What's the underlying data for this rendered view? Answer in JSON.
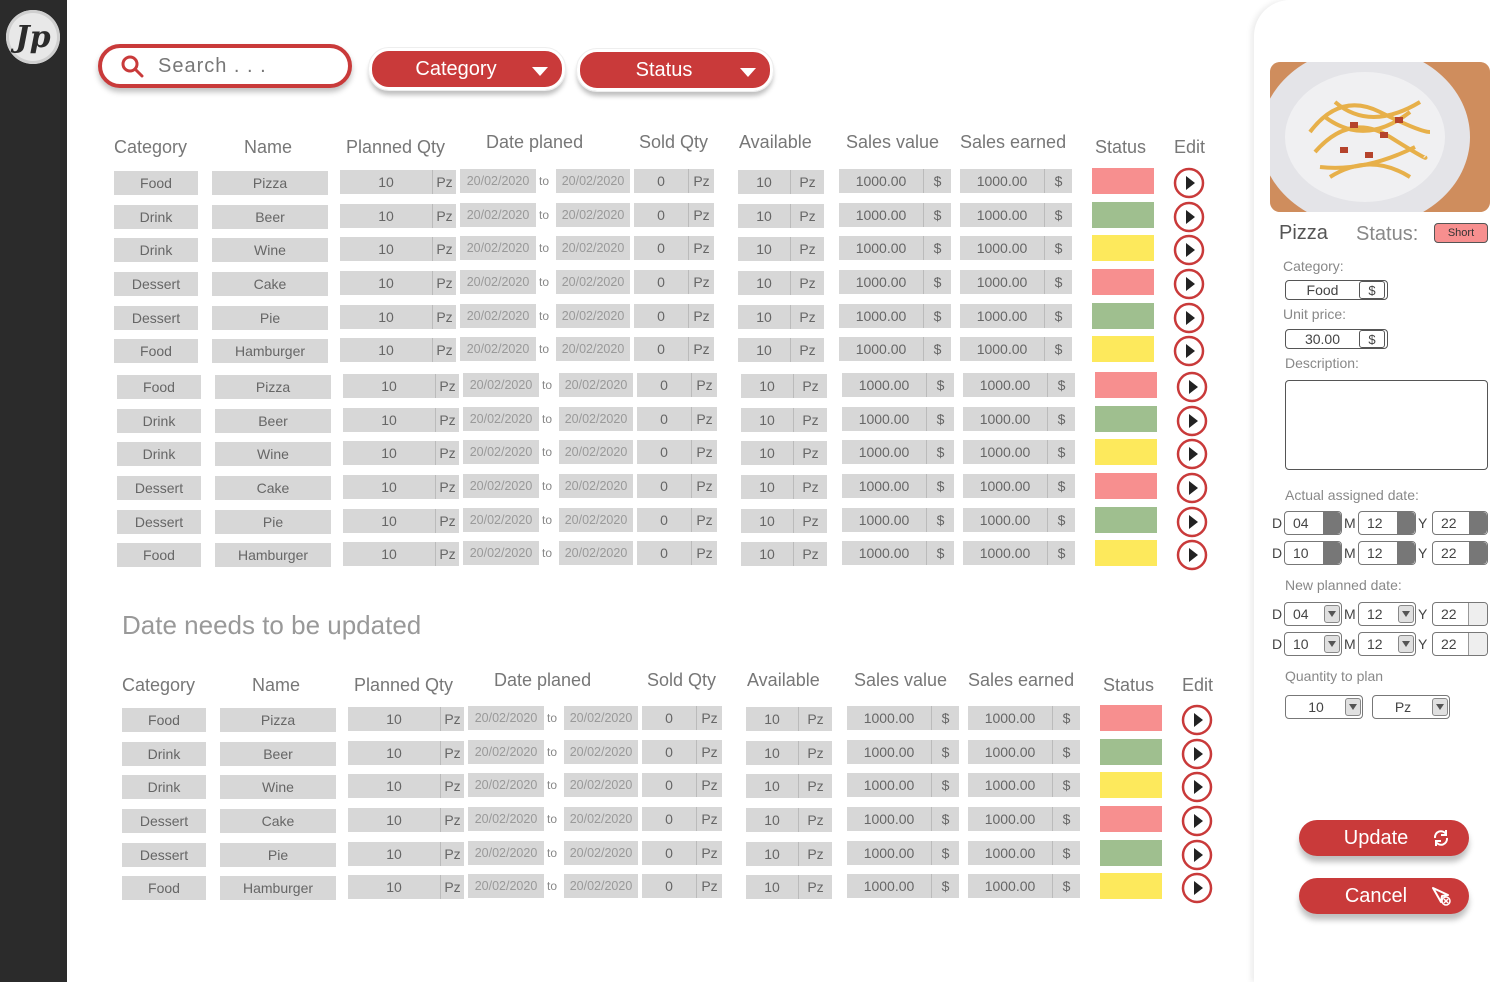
{
  "app": {
    "logo_text": "Jp"
  },
  "toolbar": {
    "search_placeholder": "Search . . .",
    "category_label": "Category",
    "status_label": "Status"
  },
  "table_headers": [
    "Category",
    "Name",
    "Planned Qty",
    "Date planed",
    "Sold Qty",
    "Available",
    "Sales value",
    "Sales earned",
    "Status",
    "Edit"
  ],
  "main_rows": [
    {
      "category": "Food",
      "name": "Pizza",
      "planned": "10",
      "unit": "Pz",
      "date_from": "20/02/2020",
      "to": "to",
      "date_to": "20/02/2020",
      "sold": "0",
      "available": "10",
      "sales_value": "1000.00",
      "currency": "$",
      "sales_earned": "1000.00",
      "status_color": "#f78f8f"
    },
    {
      "category": "Drink",
      "name": "Beer",
      "planned": "10",
      "unit": "Pz",
      "date_from": "20/02/2020",
      "to": "to",
      "date_to": "20/02/2020",
      "sold": "0",
      "available": "10",
      "sales_value": "1000.00",
      "currency": "$",
      "sales_earned": "1000.00",
      "status_color": "#9fbf8f"
    },
    {
      "category": "Drink",
      "name": "Wine",
      "planned": "10",
      "unit": "Pz",
      "date_from": "20/02/2020",
      "to": "to",
      "date_to": "20/02/2020",
      "sold": "0",
      "available": "10",
      "sales_value": "1000.00",
      "currency": "$",
      "sales_earned": "1000.00",
      "status_color": "#fde95c"
    },
    {
      "category": "Dessert",
      "name": "Cake",
      "planned": "10",
      "unit": "Pz",
      "date_from": "20/02/2020",
      "to": "to",
      "date_to": "20/02/2020",
      "sold": "0",
      "available": "10",
      "sales_value": "1000.00",
      "currency": "$",
      "sales_earned": "1000.00",
      "status_color": "#f78f8f"
    },
    {
      "category": "Dessert",
      "name": "Pie",
      "planned": "10",
      "unit": "Pz",
      "date_from": "20/02/2020",
      "to": "to",
      "date_to": "20/02/2020",
      "sold": "0",
      "available": "10",
      "sales_value": "1000.00",
      "currency": "$",
      "sales_earned": "1000.00",
      "status_color": "#9fbf8f"
    },
    {
      "category": "Food",
      "name": "Hamburger",
      "planned": "10",
      "unit": "Pz",
      "date_from": "20/02/2020",
      "to": "to",
      "date_to": "20/02/2020",
      "sold": "0",
      "available": "10",
      "sales_value": "1000.00",
      "currency": "$",
      "sales_earned": "1000.00",
      "status_color": "#fde95c"
    },
    {
      "category": "Food",
      "name": "Pizza",
      "planned": "10",
      "unit": "Pz",
      "date_from": "20/02/2020",
      "to": "to",
      "date_to": "20/02/2020",
      "sold": "0",
      "available": "10",
      "sales_value": "1000.00",
      "currency": "$",
      "sales_earned": "1000.00",
      "status_color": "#f78f8f"
    },
    {
      "category": "Drink",
      "name": "Beer",
      "planned": "10",
      "unit": "Pz",
      "date_from": "20/02/2020",
      "to": "to",
      "date_to": "20/02/2020",
      "sold": "0",
      "available": "10",
      "sales_value": "1000.00",
      "currency": "$",
      "sales_earned": "1000.00",
      "status_color": "#9fbf8f"
    },
    {
      "category": "Drink",
      "name": "Wine",
      "planned": "10",
      "unit": "Pz",
      "date_from": "20/02/2020",
      "to": "to",
      "date_to": "20/02/2020",
      "sold": "0",
      "available": "10",
      "sales_value": "1000.00",
      "currency": "$",
      "sales_earned": "1000.00",
      "status_color": "#fde95c"
    },
    {
      "category": "Dessert",
      "name": "Cake",
      "planned": "10",
      "unit": "Pz",
      "date_from": "20/02/2020",
      "to": "to",
      "date_to": "20/02/2020",
      "sold": "0",
      "available": "10",
      "sales_value": "1000.00",
      "currency": "$",
      "sales_earned": "1000.00",
      "status_color": "#f78f8f"
    },
    {
      "category": "Dessert",
      "name": "Pie",
      "planned": "10",
      "unit": "Pz",
      "date_from": "20/02/2020",
      "to": "to",
      "date_to": "20/02/2020",
      "sold": "0",
      "available": "10",
      "sales_value": "1000.00",
      "currency": "$",
      "sales_earned": "1000.00",
      "status_color": "#9fbf8f"
    },
    {
      "category": "Food",
      "name": "Hamburger",
      "planned": "10",
      "unit": "Pz",
      "date_from": "20/02/2020",
      "to": "to",
      "date_to": "20/02/2020",
      "sold": "0",
      "available": "10",
      "sales_value": "1000.00",
      "currency": "$",
      "sales_earned": "1000.00",
      "status_color": "#fde95c"
    }
  ],
  "section2_title": "Date needs to be updated",
  "update_rows": [
    {
      "category": "Food",
      "name": "Pizza",
      "planned": "10",
      "unit": "Pz",
      "date_from": "20/02/2020",
      "to": "to",
      "date_to": "20/02/2020",
      "sold": "0",
      "available": "10",
      "sales_value": "1000.00",
      "currency": "$",
      "sales_earned": "1000.00",
      "status_color": "#f78f8f"
    },
    {
      "category": "Drink",
      "name": "Beer",
      "planned": "10",
      "unit": "Pz",
      "date_from": "20/02/2020",
      "to": "to",
      "date_to": "20/02/2020",
      "sold": "0",
      "available": "10",
      "sales_value": "1000.00",
      "currency": "$",
      "sales_earned": "1000.00",
      "status_color": "#9fbf8f"
    },
    {
      "category": "Drink",
      "name": "Wine",
      "planned": "10",
      "unit": "Pz",
      "date_from": "20/02/2020",
      "to": "to",
      "date_to": "20/02/2020",
      "sold": "0",
      "available": "10",
      "sales_value": "1000.00",
      "currency": "$",
      "sales_earned": "1000.00",
      "status_color": "#fde95c"
    },
    {
      "category": "Dessert",
      "name": "Cake",
      "planned": "10",
      "unit": "Pz",
      "date_from": "20/02/2020",
      "to": "to",
      "date_to": "20/02/2020",
      "sold": "0",
      "available": "10",
      "sales_value": "1000.00",
      "currency": "$",
      "sales_earned": "1000.00",
      "status_color": "#f78f8f"
    },
    {
      "category": "Dessert",
      "name": "Pie",
      "planned": "10",
      "unit": "Pz",
      "date_from": "20/02/2020",
      "to": "to",
      "date_to": "20/02/2020",
      "sold": "0",
      "available": "10",
      "sales_value": "1000.00",
      "currency": "$",
      "sales_earned": "1000.00",
      "status_color": "#9fbf8f"
    },
    {
      "category": "Food",
      "name": "Hamburger",
      "planned": "10",
      "unit": "Pz",
      "date_from": "20/02/2020",
      "to": "to",
      "date_to": "20/02/2020",
      "sold": "0",
      "available": "10",
      "sales_value": "1000.00",
      "currency": "$",
      "sales_earned": "1000.00",
      "status_color": "#fde95c"
    }
  ],
  "detail": {
    "item_name": "Pizza",
    "status_label": "Status:",
    "status_badge": "Short",
    "category_label": "Category:",
    "category_value": "Food",
    "category_currency": "$",
    "unit_price_label": "Unit price:",
    "unit_price_value": "30.00",
    "unit_price_currency": "$",
    "description_label": "Description:",
    "description_value": "",
    "actual_date_label": "Actual assigned date:",
    "actual_dates": [
      {
        "d_letter": "D",
        "d": "04",
        "m_letter": "M",
        "m": "12",
        "y_letter": "Y",
        "y": "22"
      },
      {
        "d_letter": "D",
        "d": "10",
        "m_letter": "M",
        "m": "12",
        "y_letter": "Y",
        "y": "22"
      }
    ],
    "new_date_label": "New planned date:",
    "new_dates": [
      {
        "d_letter": "D",
        "d": "04",
        "m_letter": "M",
        "m": "12",
        "y_letter": "Y",
        "y": "22"
      },
      {
        "d_letter": "D",
        "d": "10",
        "m_letter": "M",
        "m": "12",
        "y_letter": "Y",
        "y": "22"
      }
    ],
    "quantity_label": "Quantity to plan",
    "quantity_value": "10",
    "quantity_unit": "Pz",
    "update_label": "Update",
    "cancel_label": "Cancel"
  },
  "colors": {
    "accent": "#c93a3a",
    "status_red": "#f78f8f",
    "status_green": "#9fbf8f",
    "status_yellow": "#fde95c"
  }
}
